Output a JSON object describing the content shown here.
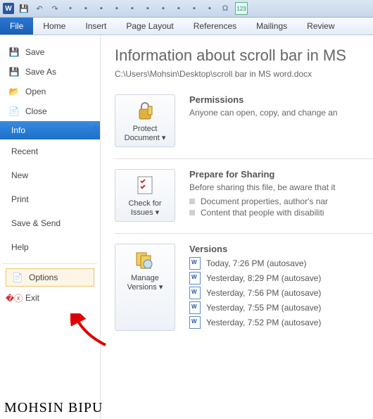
{
  "qat_icons": [
    "word",
    "save",
    "undo",
    "redo",
    "bullet",
    "",
    "",
    "",
    "",
    "",
    "",
    "",
    "",
    "",
    "",
    "omega",
    "123"
  ],
  "ribbon": {
    "file": "File",
    "home": "Home",
    "insert": "Insert",
    "pagelayout": "Page Layout",
    "references": "References",
    "mailings": "Mailings",
    "review": "Review"
  },
  "sidebar": {
    "save": "Save",
    "saveas": "Save As",
    "open": "Open",
    "close": "Close",
    "info": "Info",
    "recent": "Recent",
    "new": "New",
    "print": "Print",
    "savesend": "Save & Send",
    "help": "Help",
    "options": "Options",
    "exit": "Exit"
  },
  "main": {
    "title": "Information about scroll bar in MS",
    "path": "C:\\Users\\Mohsin\\Desktop\\scroll bar in MS word.docx",
    "perm": {
      "h": "Permissions",
      "p": "Anyone can open, copy, and change an",
      "btn": "Protect Document"
    },
    "share": {
      "h": "Prepare for Sharing",
      "p": "Before sharing this file, be aware that it",
      "b1": "Document properties, author's nar",
      "b2": "Content that people with disabiliti",
      "btn": "Check for Issues"
    },
    "ver": {
      "h": "Versions",
      "btn": "Manage Versions",
      "list": [
        "Today, 7:26 PM (autosave)",
        "Yesterday, 8:29 PM (autosave)",
        "Yesterday, 7:56 PM (autosave)",
        "Yesterday, 7:55 PM (autosave)",
        "Yesterday, 7:52 PM (autosave)"
      ]
    }
  },
  "signature": "Mohsin Bipu"
}
